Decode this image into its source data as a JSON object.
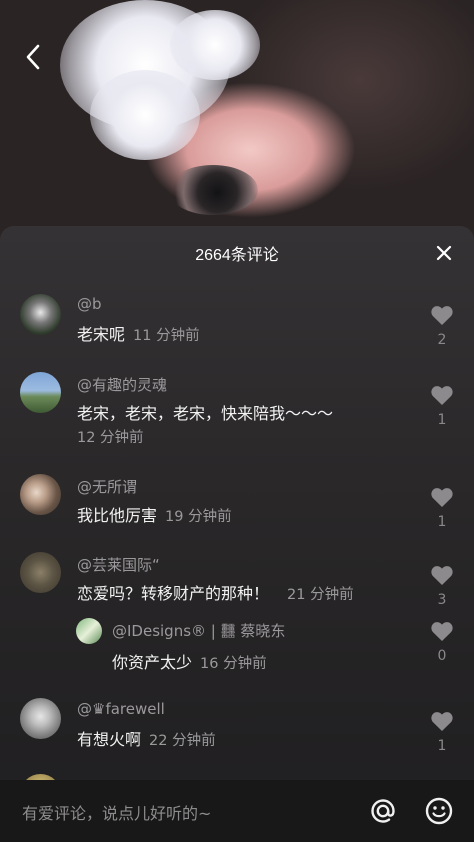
{
  "header": {
    "title": "2664条评论"
  },
  "icons": {
    "back": "chevron-left-icon",
    "close": "close-icon",
    "like": "heart-icon",
    "at": "at-icon",
    "emoji": "smiley-icon"
  },
  "colors": {
    "sheet_bg": "#2a2829",
    "username": "#9b999b",
    "comment_text": "#f2f2f2",
    "heart": "#8c8a8c",
    "input_bg": "#181818"
  },
  "comments": [
    {
      "user": "@b",
      "text": "老宋呢",
      "time": "11 分钟前",
      "likes": "2"
    },
    {
      "user": "@有趣的灵魂",
      "text": "老宋，老宋，老宋，快来陪我～～～",
      "time": "12 分钟前",
      "likes": "1"
    },
    {
      "user": "@无所谓",
      "text": "我比他厉害",
      "time": "19 分钟前",
      "likes": "1"
    },
    {
      "user": "@芸莱国际“",
      "text": "恋爱吗？转移财产的那种！",
      "time": "21 分钟前",
      "likes": "3"
    },
    {
      "user": "@IDesigns® | 䨻 蔡晓东",
      "text": "你资产太少",
      "time": "16 分钟前",
      "likes": "0"
    },
    {
      "user": "@♛farewell",
      "text": "有想火啊",
      "time": "22 分钟前",
      "likes": "1"
    }
  ],
  "input": {
    "placeholder": "有爱评论，说点儿好听的~"
  }
}
